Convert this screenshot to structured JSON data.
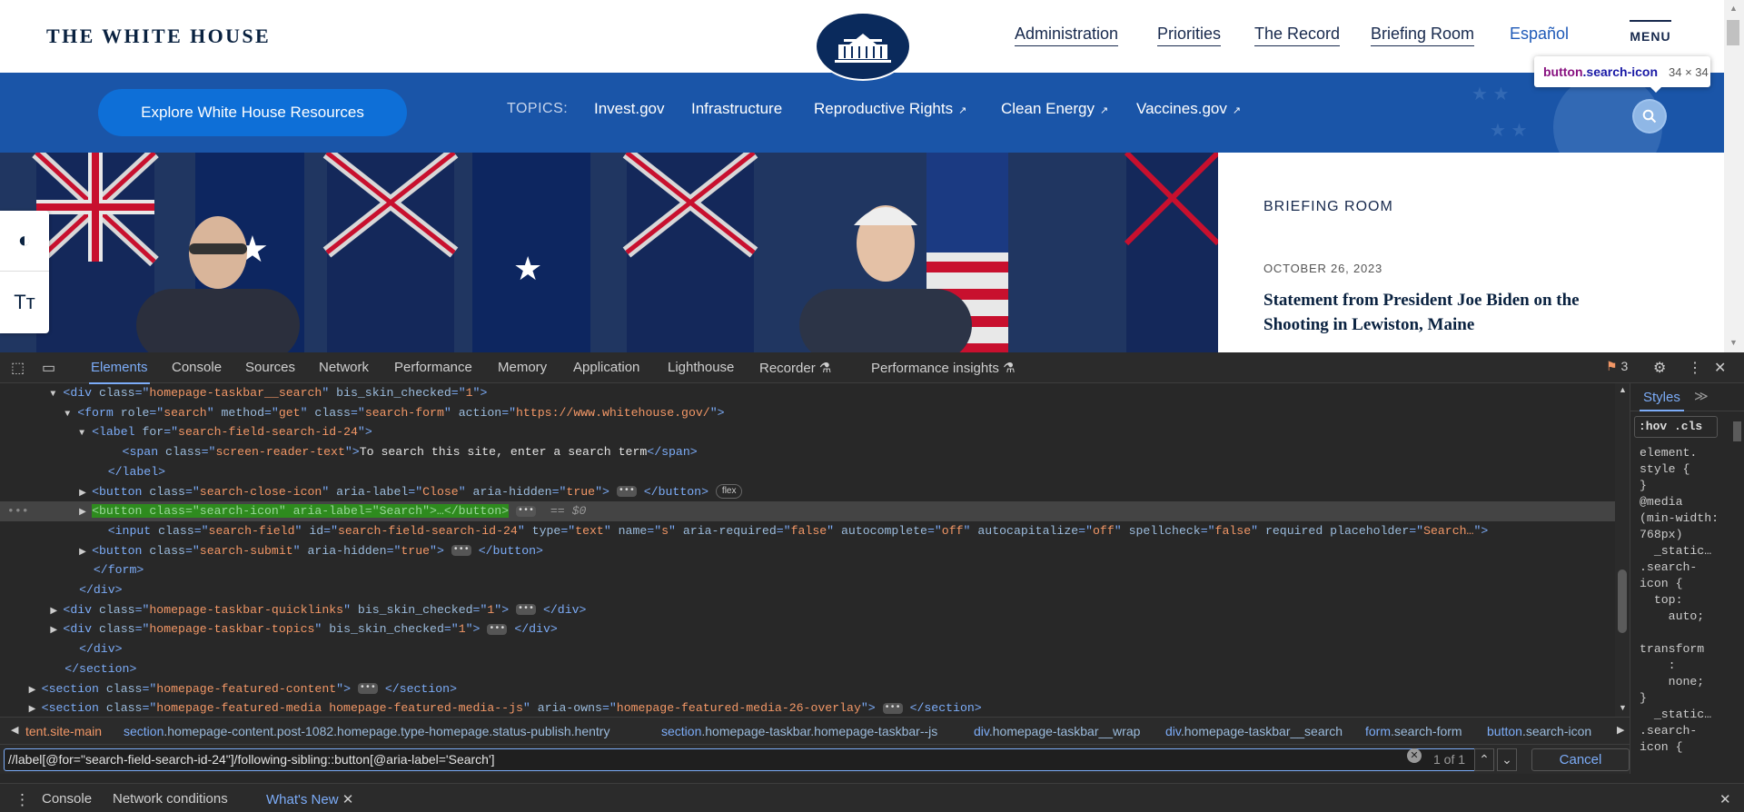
{
  "site": {
    "logo_text": "THE WHITE HOUSE",
    "nav": [
      "Administration",
      "Priorities",
      "The Record",
      "Briefing Room",
      "Español"
    ],
    "menu_label": "MENU",
    "explore_label": "Explore White House Resources",
    "topics_label": "TOPICS:",
    "topics": [
      {
        "label": "Invest.gov",
        "external": ""
      },
      {
        "label": "Infrastructure",
        "external": ""
      },
      {
        "label": "Reproductive Rights",
        "external": "↗"
      },
      {
        "label": "Clean Energy",
        "external": "↗"
      },
      {
        "label": "Vaccines.gov",
        "external": "↗"
      }
    ],
    "tooltip": {
      "tag": "button",
      "cls": ".search-icon",
      "size": "34 × 34"
    },
    "briefing": {
      "kicker": "BRIEFING ROOM",
      "date": "OCTOBER 26, 2023",
      "title": "Statement from President Joe Biden on the Shooting in Lewiston, Maine"
    },
    "side_tools": [
      "contrast-icon",
      "text-size-icon"
    ]
  },
  "devtools": {
    "tabs": [
      "Elements",
      "Console",
      "Sources",
      "Network",
      "Performance",
      "Memory",
      "Application",
      "Lighthouse",
      "Recorder",
      "Performance insights"
    ],
    "active_tab": "Elements",
    "issues_count": "3",
    "styles_tab": "Styles",
    "styles_filter": ":hov .cls",
    "styles_text": "element.\nstyle {\n}\n@media\n(min-width:\n768px)\n  _static…\n.search-\nicon {\n  top:\n    auto;\n\ntransform\n    :\n    none;\n}\n  _static…\n.search-\nicon {",
    "dom_dollar": "== $0",
    "breadcrumbs": [
      {
        "tag": "",
        "cls": "tent.site-main"
      },
      {
        "tag": "section",
        "cls": ".homepage-content.post-1082.homepage.type-homepage.status-publish.hentry"
      },
      {
        "tag": "section",
        "cls": ".homepage-taskbar.homepage-taskbar--js"
      },
      {
        "tag": "div",
        "cls": ".homepage-taskbar__wrap"
      },
      {
        "tag": "div",
        "cls": ".homepage-taskbar__search"
      },
      {
        "tag": "form",
        "cls": ".search-form"
      },
      {
        "tag": "button",
        "cls": ".search-icon"
      }
    ],
    "search_query": "//label[@for=\"search-field-search-id-24\"]/following-sibling::button[@aria-label='Search']",
    "match_count": "1 of 1",
    "cancel_label": "Cancel",
    "drawer_tabs": [
      "Console",
      "Network conditions",
      "What's New"
    ],
    "drawer_active": "What's New",
    "colors": {
      "accent": "#7cacf8",
      "site_blue": "#1a55a8",
      "navy": "#0a2240"
    }
  }
}
